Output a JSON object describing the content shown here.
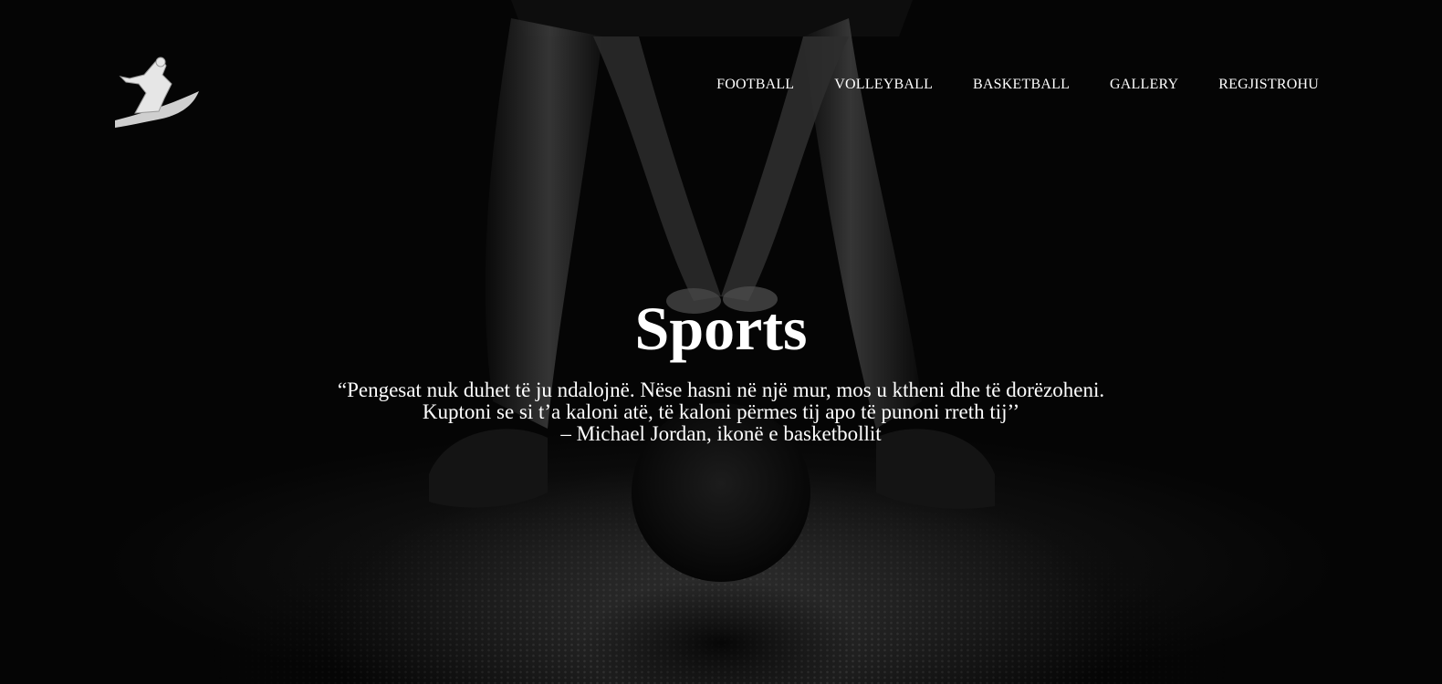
{
  "logo": {
    "icon": "jumping-athlete-logo"
  },
  "nav": {
    "items": [
      {
        "label": "FOOTBALL"
      },
      {
        "label": "VOLLEYBALL"
      },
      {
        "label": "BASKETBALL"
      },
      {
        "label": "GALLERY"
      },
      {
        "label": "REGJISTROHU"
      }
    ]
  },
  "hero": {
    "background": "dark photo of athlete crouched over a basketball",
    "title": "Sports",
    "quote_lines": [
      "“Pengesat nuk duhet të ju ndalojnë. Nëse hasni në një mur, mos u ktheni dhe të dorëzoheni.",
      "Kuptoni se si t’a kaloni atë, të kaloni përmes tij apo të punoni rreth tij’’",
      "– Michael Jordan, ikonë e basketbollit"
    ]
  },
  "colors": {
    "background": "#000000",
    "text": "#ffffff"
  }
}
